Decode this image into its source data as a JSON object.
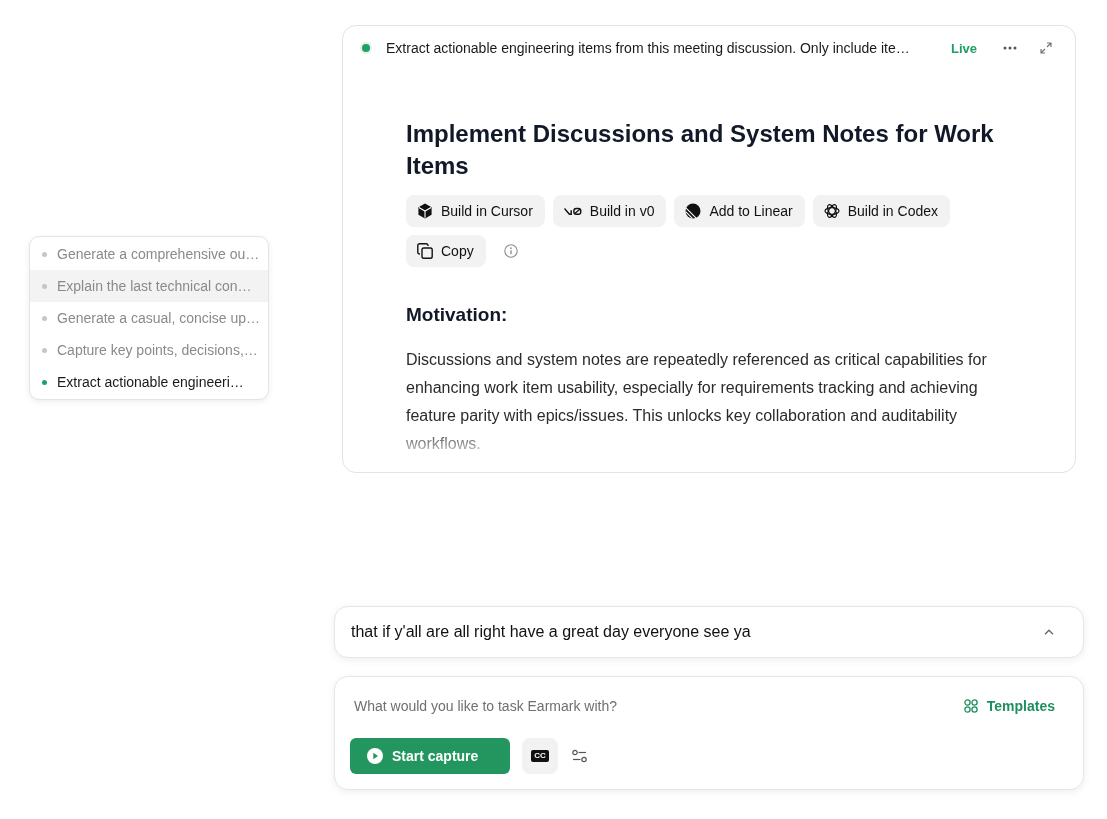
{
  "menu": {
    "items": [
      {
        "label": "Generate a comprehensive ou…",
        "selected": false,
        "highlighted": false
      },
      {
        "label": "Explain the last technical con…",
        "selected": false,
        "highlighted": true
      },
      {
        "label": "Generate a casual, concise up…",
        "selected": false,
        "highlighted": false
      },
      {
        "label": "Capture key points, decisions,…",
        "selected": false,
        "highlighted": false
      },
      {
        "label": "Extract actionable engineeri…",
        "selected": true,
        "highlighted": false
      }
    ]
  },
  "task_card": {
    "prompt": "Extract actionable engineering items from this meeting discussion. Only include ite…",
    "status": "Live",
    "title": "Implement Discussions and System Notes for Work Items",
    "actions": [
      {
        "kind": "cursor",
        "label": "Build in Cursor"
      },
      {
        "kind": "v0",
        "label": "Build in v0"
      },
      {
        "kind": "linear",
        "label": "Add to Linear"
      },
      {
        "kind": "codex",
        "label": "Build in Codex"
      },
      {
        "kind": "copy",
        "label": "Copy"
      }
    ],
    "section_heading": "Motivation:",
    "body": "Discussions and system notes are repeatedly referenced as critical capabilities for enhancing work item usability, especially for requirements tracking and achieving feature parity with epics/issues. This unlocks key collaboration and auditability workflows."
  },
  "transcript": {
    "text": "that if y'all are all right have a great day everyone see ya"
  },
  "composer": {
    "placeholder": "What would you like to task Earmark with?",
    "templates_label": "Templates",
    "start_button": "Start capture",
    "captions_label": "CC"
  }
}
